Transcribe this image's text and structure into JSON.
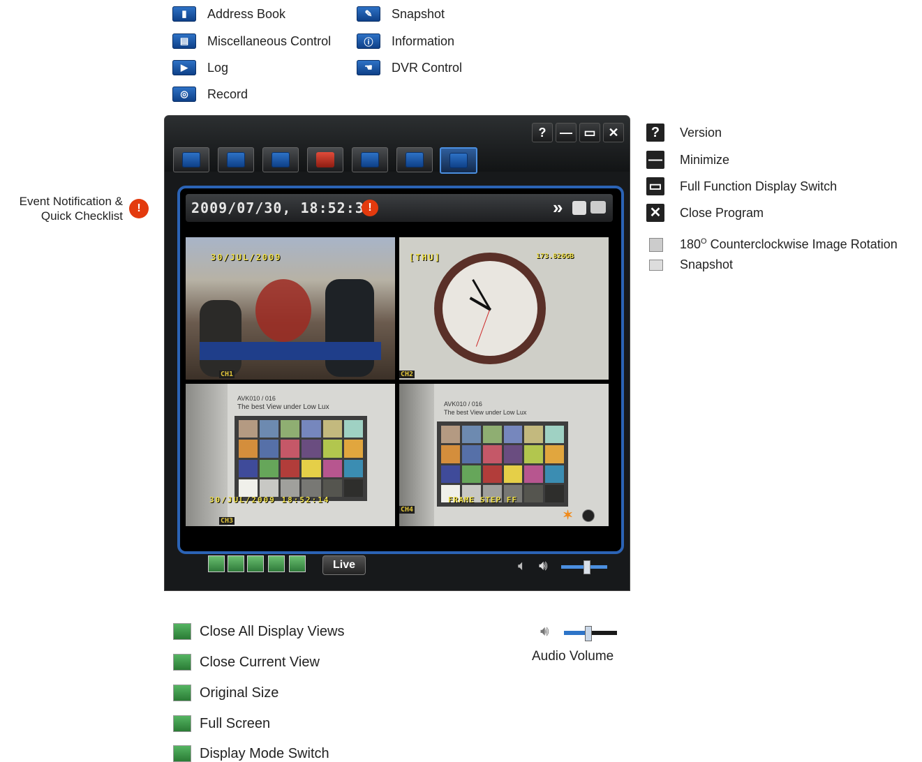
{
  "top_legend": [
    {
      "label": "Address Book",
      "icon": "address-book-icon"
    },
    {
      "label": "Snapshot",
      "icon": "snapshot-icon"
    },
    {
      "label": "Miscellaneous Control",
      "icon": "misc-control-icon"
    },
    {
      "label": "Information",
      "icon": "information-icon"
    },
    {
      "label": "Log",
      "icon": "log-icon"
    },
    {
      "label": "DVR Control",
      "icon": "dvr-control-icon"
    },
    {
      "label": "Record",
      "icon": "record-icon"
    }
  ],
  "left_callout": {
    "line1": "Event Notification &",
    "line2": "Quick Checklist"
  },
  "window": {
    "buttons": {
      "help": "?",
      "minimize": "—",
      "maximize": "▭",
      "close": "✕"
    },
    "status": {
      "timestamp": "2009/07/30, 18:52:36",
      "forward": "»"
    },
    "channels": [
      "CH1",
      "CH2",
      "CH3",
      "CH4"
    ],
    "osd": {
      "ch1_date": "30/JUL/2009",
      "ch2_day": "[THU]",
      "ch2_size": "173.826GB",
      "ch3_date": "30/JUL/2009  18:52:14",
      "ch4_label": "FRAME  STEP FF",
      "test_text": "AVK010 / 016",
      "test_sub": "The best View under Low Lux"
    },
    "live_label": "Live"
  },
  "right_legend": [
    {
      "label": "Version",
      "glyph": "?"
    },
    {
      "label": "Minimize",
      "glyph": "—"
    },
    {
      "label": "Full Function Display Switch",
      "glyph": "▭"
    },
    {
      "label": "Close Program",
      "glyph": "✕"
    }
  ],
  "right_small_legend": [
    {
      "label": "180",
      "sup": "O",
      "rest": " Counterclockwise Image Rotation",
      "icon": "rotate-icon"
    },
    {
      "label": "Snapshot",
      "icon": "snapshot-small-icon"
    }
  ],
  "bottom_legend": [
    {
      "label": "Close All Display Views"
    },
    {
      "label": "Close Current View"
    },
    {
      "label": "Original Size"
    },
    {
      "label": "Full Screen"
    },
    {
      "label": "Display Mode Switch"
    }
  ],
  "audio": {
    "label": "Audio Volume",
    "level": 0.45
  },
  "colors": {
    "accent_blue": "#2b63b5",
    "warning": "#e33a0e",
    "green": "#3c9a48"
  }
}
